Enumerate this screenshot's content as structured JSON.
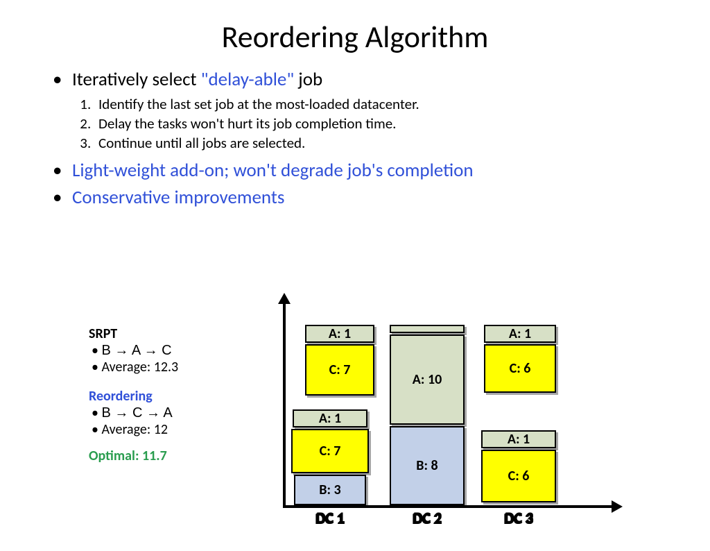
{
  "title": "Reordering Algorithm",
  "bullet1_prefix": "Iteratively select ",
  "bullet1_mid": "\"delay-able\"",
  "bullet1_suffix": " job",
  "steps": [
    "Identify the last set job at the most-loaded datacenter.",
    "Delay the tasks won't hurt its job completion time.",
    "Continue until all jobs are selected."
  ],
  "bullet2": "Light-weight add-on; won't degrade job's completion",
  "bullet3": "Conservative improvements",
  "notes": {
    "srpt_label": "SRPT",
    "srpt_order": "B → A → C",
    "srpt_avg": "Average: 12.3",
    "reorder_label": "Reordering",
    "reorder_order": "B → C → A",
    "reorder_avg": "Average: 12",
    "optimal": "Optimal: 11.7"
  },
  "chart_data": {
    "type": "bar",
    "categories": [
      "DC 1",
      "DC 2",
      "DC 3"
    ],
    "series": [
      {
        "name": "A",
        "values": [
          1,
          10,
          1
        ]
      },
      {
        "name": "B",
        "values": [
          3,
          8,
          0
        ]
      },
      {
        "name": "C",
        "values": [
          7,
          0,
          6
        ]
      }
    ],
    "xlabel": "",
    "ylabel": "",
    "note": "DC1 and DC3 columns show duplicated/offset C+A stacks (reordering illustration)"
  },
  "blocks": {
    "a1": "A: 1",
    "a10": "A: 10",
    "b3": "B: 3",
    "b8": "B: 8",
    "c6": "C: 6",
    "c7": "C: 7",
    "dc1": "DC 1",
    "dc2": "DC 2",
    "dc3": "DC 3"
  }
}
